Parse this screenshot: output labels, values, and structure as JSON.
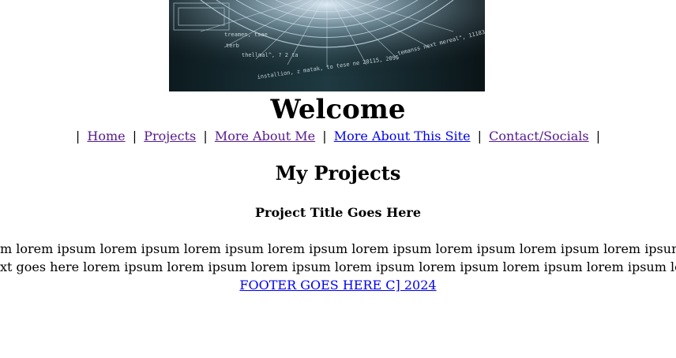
{
  "heading": "Welcome",
  "nav": {
    "separator": "|",
    "items": [
      {
        "label": "Home"
      },
      {
        "label": "Projects"
      },
      {
        "label": "More About Me"
      },
      {
        "label": "More About This Site"
      },
      {
        "label": "Contact/Socials"
      }
    ]
  },
  "projects": {
    "title": "My Projects",
    "project_title": "Project Title Goes Here",
    "line1": "m lorem ipsum lorem ipsum lorem ipsum lorem ipsum lorem ipsum lorem ipsum lorem ipsum lorem ipsum lorem ipsum lorem",
    "line2": "xt goes here lorem ipsum lorem ipsum lorem ipsum lorem ipsum lorem ipsum lorem ipsum lorem ipsum lorem ipsum lorem ip"
  },
  "footer": {
    "text": "FOOTER GOES HERE C] 2024"
  },
  "hero_image": {
    "code_lines": [
      "treamen, tsae",
      "terb",
      "thellmal^, ? 2 ta",
      "installion, z matak, to tese ne 20115, 2095",
      "temanss next mereal\", 11183)"
    ]
  },
  "colors": {
    "visited_link": "#551a8b",
    "link": "#0000ee",
    "hero_bg": "#05080b"
  }
}
